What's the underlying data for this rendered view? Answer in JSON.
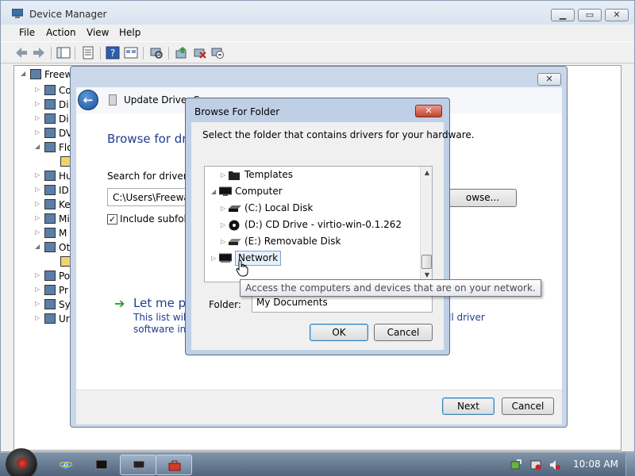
{
  "device_manager": {
    "title": "Device Manager",
    "menu": [
      "File",
      "Action",
      "View",
      "Help"
    ],
    "tree": [
      {
        "label": "Freew",
        "expander": "◢"
      },
      {
        "label": "Co",
        "expander": "▷"
      },
      {
        "label": "Di",
        "expander": "▷"
      },
      {
        "label": "Di",
        "expander": "▷"
      },
      {
        "label": "DV",
        "expander": "▷"
      },
      {
        "label": "Flo",
        "expander": "◢"
      },
      {
        "label": "",
        "expander": ""
      },
      {
        "label": "Hu",
        "expander": "▷"
      },
      {
        "label": "ID",
        "expander": "▷"
      },
      {
        "label": "Ke",
        "expander": "▷"
      },
      {
        "label": "Mi",
        "expander": "▷"
      },
      {
        "label": "M",
        "expander": "▷"
      },
      {
        "label": "Ot",
        "expander": "◢"
      },
      {
        "label": "",
        "expander": ""
      },
      {
        "label": "Po",
        "expander": "▷"
      },
      {
        "label": "Pr",
        "expander": "▷"
      },
      {
        "label": "Sy",
        "expander": "▷"
      },
      {
        "label": "Ur",
        "expander": "▷"
      }
    ]
  },
  "update_driver": {
    "header_title": "Update Driver So",
    "heading": "Browse for dri",
    "search_label": "Search for driver so",
    "path_value": "C:\\Users\\Freeware",
    "browse_label": "owse...",
    "include_label": "Include subfold",
    "include_checked": "✓",
    "let_me_pick": "Let me pi",
    "list_text_1": "This list will s",
    "list_text_2": "software in t",
    "list_tail_1": "ll driver",
    "next_label": "Next",
    "cancel_label": "Cancel",
    "close_glyph": "✕"
  },
  "browse_folder": {
    "title": "Browse For Folder",
    "close_glyph": "✕",
    "instruction": "Select the folder that contains drivers for your hardware.",
    "tree": [
      {
        "label": "Templates",
        "expander": "▷",
        "icon": "folder-icon",
        "indent": 1
      },
      {
        "label": "Computer",
        "expander": "◢",
        "icon": "computer-icon",
        "indent": 0
      },
      {
        "label": "(C:) Local Disk",
        "expander": "▷",
        "icon": "drive-icon",
        "indent": 1
      },
      {
        "label": "(D:) CD Drive - virtio-win-0.1.262",
        "expander": "▷",
        "icon": "cd-icon",
        "indent": 1
      },
      {
        "label": "(E:) Removable Disk",
        "expander": "▷",
        "icon": "removable-drive-icon",
        "indent": 1
      },
      {
        "label": "Network",
        "expander": "▷",
        "icon": "network-icon",
        "indent": 0
      }
    ],
    "folder_label": "Folder:",
    "folder_value": "My Documents",
    "ok_label": "OK",
    "cancel_label": "Cancel",
    "tooltip": "Access the computers and devices that are on your network."
  },
  "taskbar": {
    "clock": "10:08 AM"
  },
  "colors": {
    "accent": "#1e3d8f",
    "close_red": "#c5432c",
    "selection": "#e6f0fb"
  }
}
